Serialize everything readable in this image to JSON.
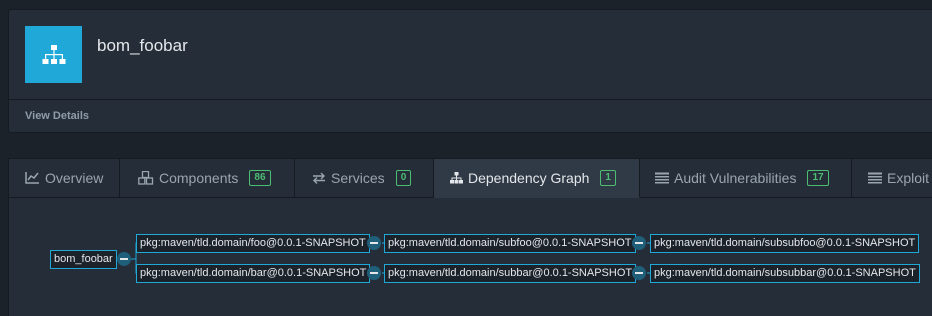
{
  "project": {
    "title": "bom_foobar",
    "icon": "sitemap-icon",
    "view_details_label": "View Details"
  },
  "tabs": [
    {
      "label": "Overview",
      "icon": "line-chart-icon",
      "badge": null,
      "active": false
    },
    {
      "label": "Components",
      "icon": "cubes-icon",
      "badge": "86",
      "active": false
    },
    {
      "label": "Services",
      "icon": "exchange-icon",
      "badge": "0",
      "active": false
    },
    {
      "label": "Dependency Graph",
      "icon": "sitemap-icon",
      "badge": "1",
      "active": true
    },
    {
      "label": "Audit Vulnerabilities",
      "icon": "tasks-icon",
      "badge": "17",
      "active": false
    },
    {
      "label": "Exploit",
      "icon": "tasks-icon",
      "badge": null,
      "active": false
    }
  ],
  "graph": {
    "root": "bom_foobar",
    "level1": [
      "pkg:maven/tld.domain/foo@0.0.1-SNAPSHOT",
      "pkg:maven/tld.domain/bar@0.0.1-SNAPSHOT"
    ],
    "level2": [
      "pkg:maven/tld.domain/subfoo@0.0.1-SNAPSHOT",
      "pkg:maven/tld.domain/subbar@0.0.1-SNAPSHOT"
    ],
    "level3": [
      "pkg:maven/tld.domain/subsubfoo@0.0.1-SNAPSHOT",
      "pkg:maven/tld.domain/subsubbar@0.0.1-SNAPSHOT"
    ]
  },
  "colors": {
    "accent": "#20a8d8",
    "badge": "#4dbd74",
    "background": "#1b222a",
    "panel": "#252e38"
  }
}
